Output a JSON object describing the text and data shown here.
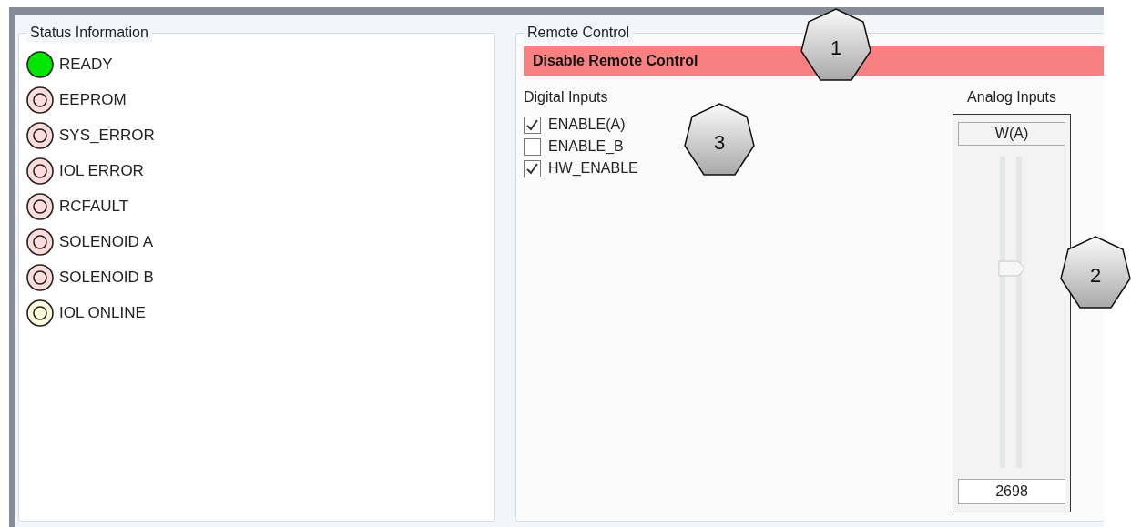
{
  "status_information": {
    "title": "Status Information",
    "indicators": [
      {
        "label": "READY",
        "on": true,
        "color": "#00e600"
      },
      {
        "label": "EEPROM",
        "on": false,
        "color": "#ffdcdc"
      },
      {
        "label": "SYS_ERROR",
        "on": false,
        "color": "#ffdcdc"
      },
      {
        "label": "IOL ERROR",
        "on": false,
        "color": "#ffdcdc"
      },
      {
        "label": "RCFAULT",
        "on": false,
        "color": "#ffdcdc"
      },
      {
        "label": "SOLENOID A",
        "on": false,
        "color": "#ffdcdc"
      },
      {
        "label": "SOLENOID B",
        "on": false,
        "color": "#ffdcdc"
      },
      {
        "label": "IOL ONLINE",
        "on": false,
        "color": "#fffadc"
      }
    ]
  },
  "remote_control": {
    "title": "Remote Control",
    "button": "Disable Remote Control",
    "digital_inputs": {
      "title": "Digital Inputs",
      "items": [
        {
          "label": "ENABLE(A)",
          "checked": true
        },
        {
          "label": "ENABLE_B",
          "checked": false
        },
        {
          "label": "HW_ENABLE",
          "checked": true
        }
      ]
    },
    "analog_inputs": {
      "title": "Analog Inputs",
      "channel": "W(A)",
      "level": 0.64,
      "reading": "2698"
    }
  },
  "callouts": [
    "1",
    "2",
    "3"
  ]
}
